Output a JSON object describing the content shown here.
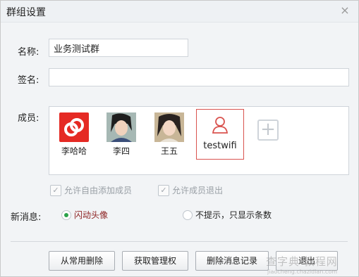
{
  "dialog": {
    "title": "群组设置",
    "close_glyph": "×"
  },
  "form": {
    "name_label": "名称:",
    "name_value": "业务测试群",
    "signature_label": "签名:",
    "signature_value": "",
    "members_label": "成员:"
  },
  "members": [
    {
      "name": "李哈哈",
      "avatar": "red-link-logo"
    },
    {
      "name": "李四",
      "avatar": "photo-avatar"
    },
    {
      "name": "王五",
      "avatar": "photo-avatar"
    },
    {
      "name": "testwifi",
      "avatar": "user-outline-icon"
    }
  ],
  "add_member_glyph": "+",
  "options": {
    "allow_free_add": "允许自由添加成员",
    "allow_member_exit": "允许成员退出"
  },
  "new_message": {
    "label": "新消息:",
    "flash_avatar": "闪动头像",
    "no_notify": "不提示，只显示条数"
  },
  "buttons": {
    "remove_common": "从常用删除",
    "get_admin": "获取管理权",
    "delete_history": "删除消息记录",
    "exit_group": "退出"
  },
  "watermark": {
    "text": "查字典 教程网",
    "sub": "jiaocheng.chazidian.com"
  },
  "colors": {
    "accent_red": "#d9534f",
    "radio_green": "#2aa24a",
    "highlight_text": "#8b1f1f"
  }
}
